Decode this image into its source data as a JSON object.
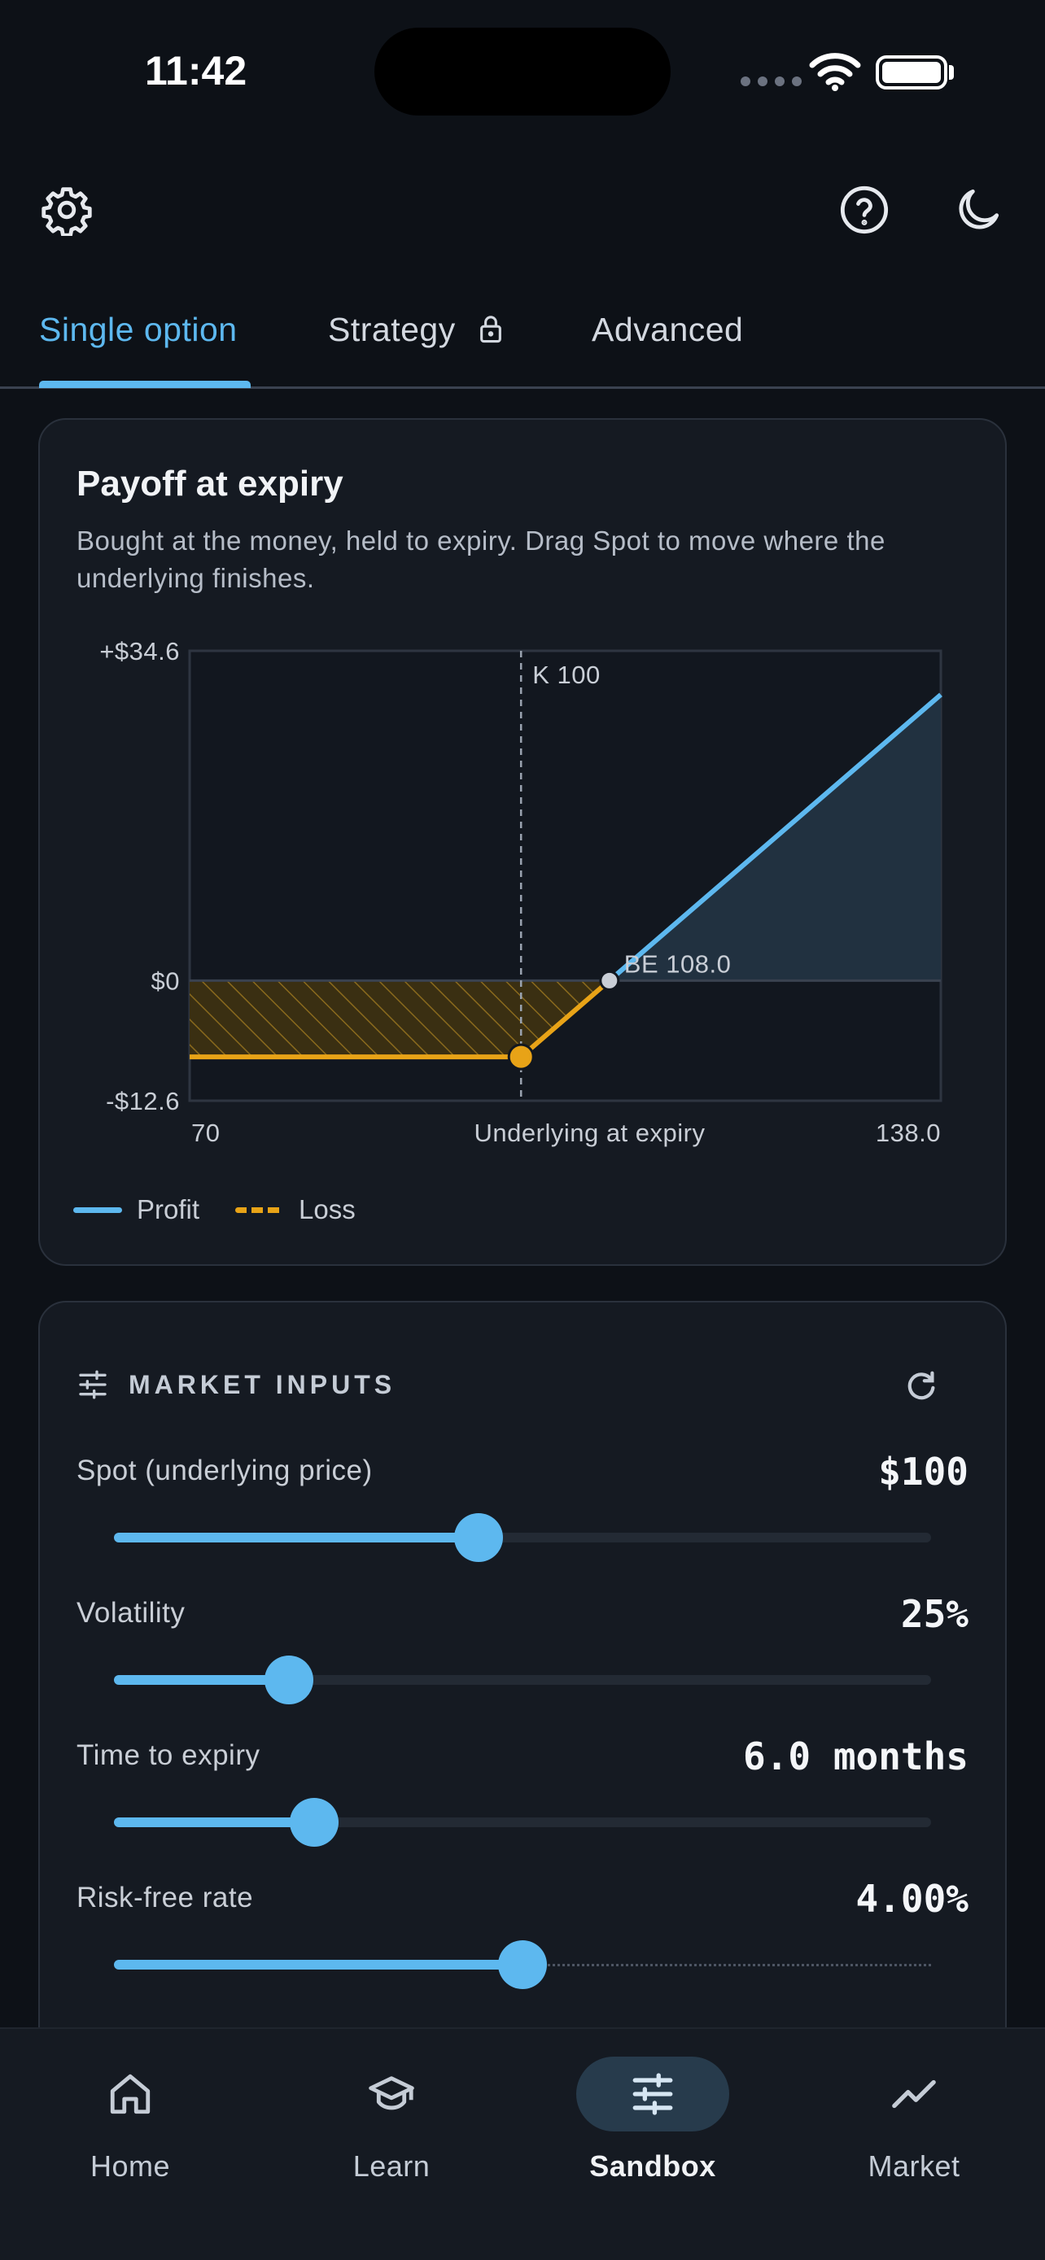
{
  "status_bar": {
    "time": "11:42"
  },
  "tabs": [
    {
      "label": "Single option",
      "active": true
    },
    {
      "label": "Strategy",
      "locked": true
    },
    {
      "label": "Advanced"
    }
  ],
  "payoff": {
    "title": "Payoff at expiry",
    "description": "Bought at the money, held to expiry. Drag Spot to move where the underlying finishes.",
    "legend": {
      "profit": "Profit",
      "loss": "Loss"
    }
  },
  "chart_data": {
    "type": "line",
    "title": "Payoff at expiry",
    "xlabel": "Underlying at expiry",
    "ylabel": "",
    "xlim": [
      70,
      138.0
    ],
    "ylim": [
      -12.6,
      34.6
    ],
    "x_tick_labels": [
      "70",
      "138.0"
    ],
    "y_tick_labels": [
      "+$34.6",
      "$0",
      "-$12.6"
    ],
    "strike": 100,
    "strike_label": "K 100",
    "breakeven": 108.0,
    "breakeven_label": "BE 108.0",
    "spot_marker": {
      "x": 100,
      "y": -8.0
    },
    "series": [
      {
        "name": "Loss",
        "color": "#e8a317",
        "points": [
          [
            70,
            -8.0
          ],
          [
            100,
            -8.0
          ],
          [
            108.0,
            0
          ]
        ]
      },
      {
        "name": "Profit",
        "color": "#5db8ef",
        "points": [
          [
            108.0,
            0
          ],
          [
            138.0,
            30.0
          ]
        ]
      }
    ],
    "grid": false,
    "legend": "bottom-left"
  },
  "market_inputs": {
    "title": "MARKET INPUTS",
    "sliders": [
      {
        "label": "Spot (underlying price)",
        "value": "$100",
        "fraction": 0.446
      },
      {
        "label": "Volatility",
        "value": "25%",
        "fraction": 0.214
      },
      {
        "label": "Time to expiry",
        "value": "6.0 months",
        "fraction": 0.245
      },
      {
        "label": "Risk-free rate",
        "value": "4.00%",
        "fraction": 0.5,
        "dotted": true
      }
    ]
  },
  "nav": [
    {
      "label": "Home",
      "icon": "home-icon"
    },
    {
      "label": "Learn",
      "icon": "graduation-cap-icon"
    },
    {
      "label": "Sandbox",
      "icon": "sliders-icon",
      "active": true
    },
    {
      "label": "Market",
      "icon": "trend-line-icon"
    }
  ],
  "colors": {
    "accent": "#5db8ef",
    "loss": "#e8a317",
    "background": "#0d1117",
    "card": "#151a22"
  }
}
